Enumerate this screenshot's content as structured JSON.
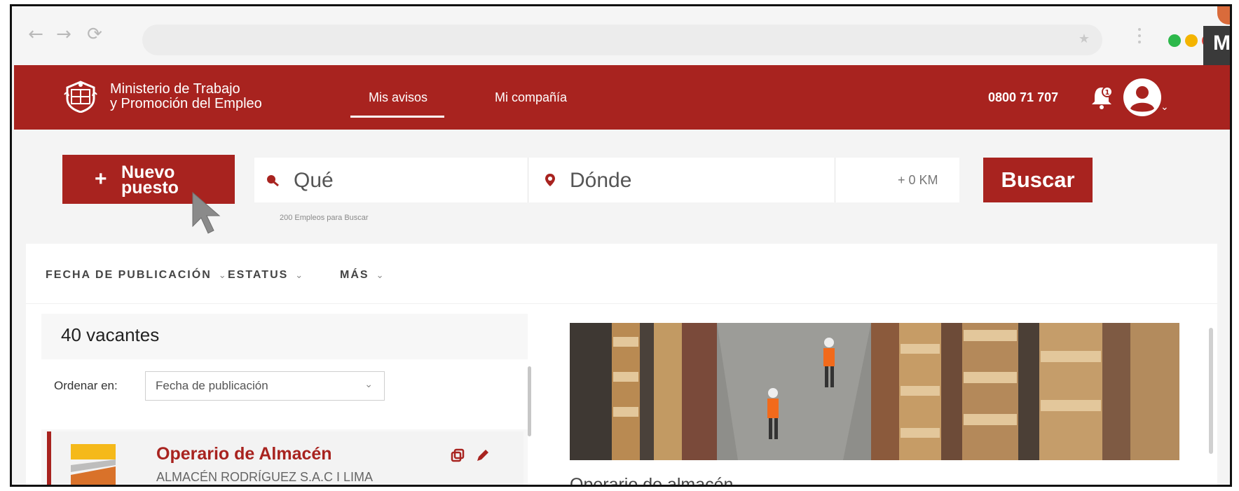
{
  "browser": {
    "back_icon": "back-arrow-icon",
    "forward_icon": "forward-arrow-icon",
    "reload_icon": "reload-icon",
    "window_dots": [
      "#2db84b",
      "#f4b400",
      "#e8453c"
    ],
    "tab_letter": "M"
  },
  "header": {
    "logo_line1": "Ministerio de Trabajo",
    "logo_line2": "y Promoción del Empleo",
    "nav": [
      "Mis avisos",
      "Mi compañía"
    ],
    "active_nav": "Mis avisos",
    "phone": "0800 71 707",
    "brand_color": "#a8231f"
  },
  "search": {
    "new_button_plus": "+",
    "new_button_label": "Nuevo\npuesto",
    "what_placeholder": "Qué",
    "where_placeholder": "Dónde",
    "distance": "+ 0 KM",
    "submit_label": "Buscar",
    "helper_text": "200 Empleos para Buscar"
  },
  "filters": {
    "items": [
      "FECHA DE PUBLICACIÓN",
      "ESTATUS",
      "MÁS"
    ]
  },
  "results": {
    "count_label": "40 vacantes",
    "sort_label": "Ordenar en:",
    "sort_value": "Fecha de publicación",
    "jobs": [
      {
        "title": "Operario de Almacén",
        "company": "ALMACÉN RODRÍGUEZ S.A.C  I  LIMA"
      }
    ]
  },
  "detail": {
    "title": "Operario de almacén",
    "image": "warehouse-workers-photo"
  }
}
